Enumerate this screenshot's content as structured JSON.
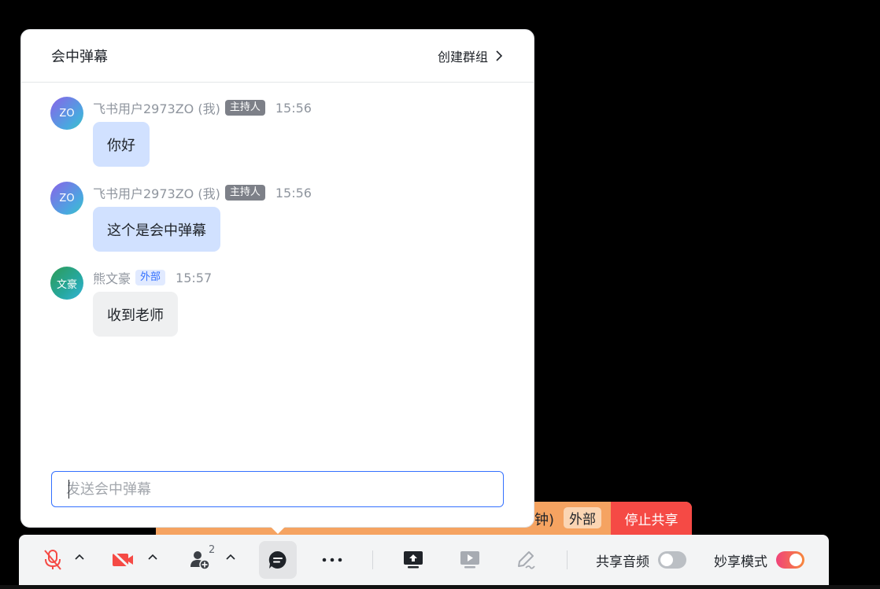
{
  "panel": {
    "title": "会中弹幕",
    "create_group": "创建群组"
  },
  "messages": [
    {
      "avatar": "ZO",
      "sender": "飞书用户2973ZO (我)",
      "badge": "主持人",
      "time": "15:56",
      "text": "你好"
    },
    {
      "avatar": "ZO",
      "sender": "飞书用户2973ZO (我)",
      "badge": "主持人",
      "time": "15:56",
      "text": "这个是会中弹幕"
    },
    {
      "avatar": "文豪",
      "sender": "熊文豪",
      "badge": "外部",
      "time": "15:57",
      "text": "收到老师"
    }
  ],
  "input": {
    "placeholder": "发送会中弹幕",
    "value": ""
  },
  "share_bar": {
    "partial_text": "钟)",
    "external_badge": "外部",
    "stop_label": "停止共享"
  },
  "toolbar": {
    "participant_count": "2",
    "share_audio_label": "共享音频",
    "share_audio_on": false,
    "smart_share_label": "妙享模式",
    "smart_share_on": true,
    "icons": [
      "mic-muted-icon",
      "camera-off-icon",
      "participants-icon",
      "chat-icon",
      "more-icon",
      "share-screen-icon",
      "present-icon",
      "annotate-icon"
    ]
  },
  "colors": {
    "accent": "#3370ff",
    "host_badge": "#7d8088",
    "stop_share": "#f54a45",
    "share_bar": "#f5a361",
    "muted_red": "#f54a45"
  }
}
